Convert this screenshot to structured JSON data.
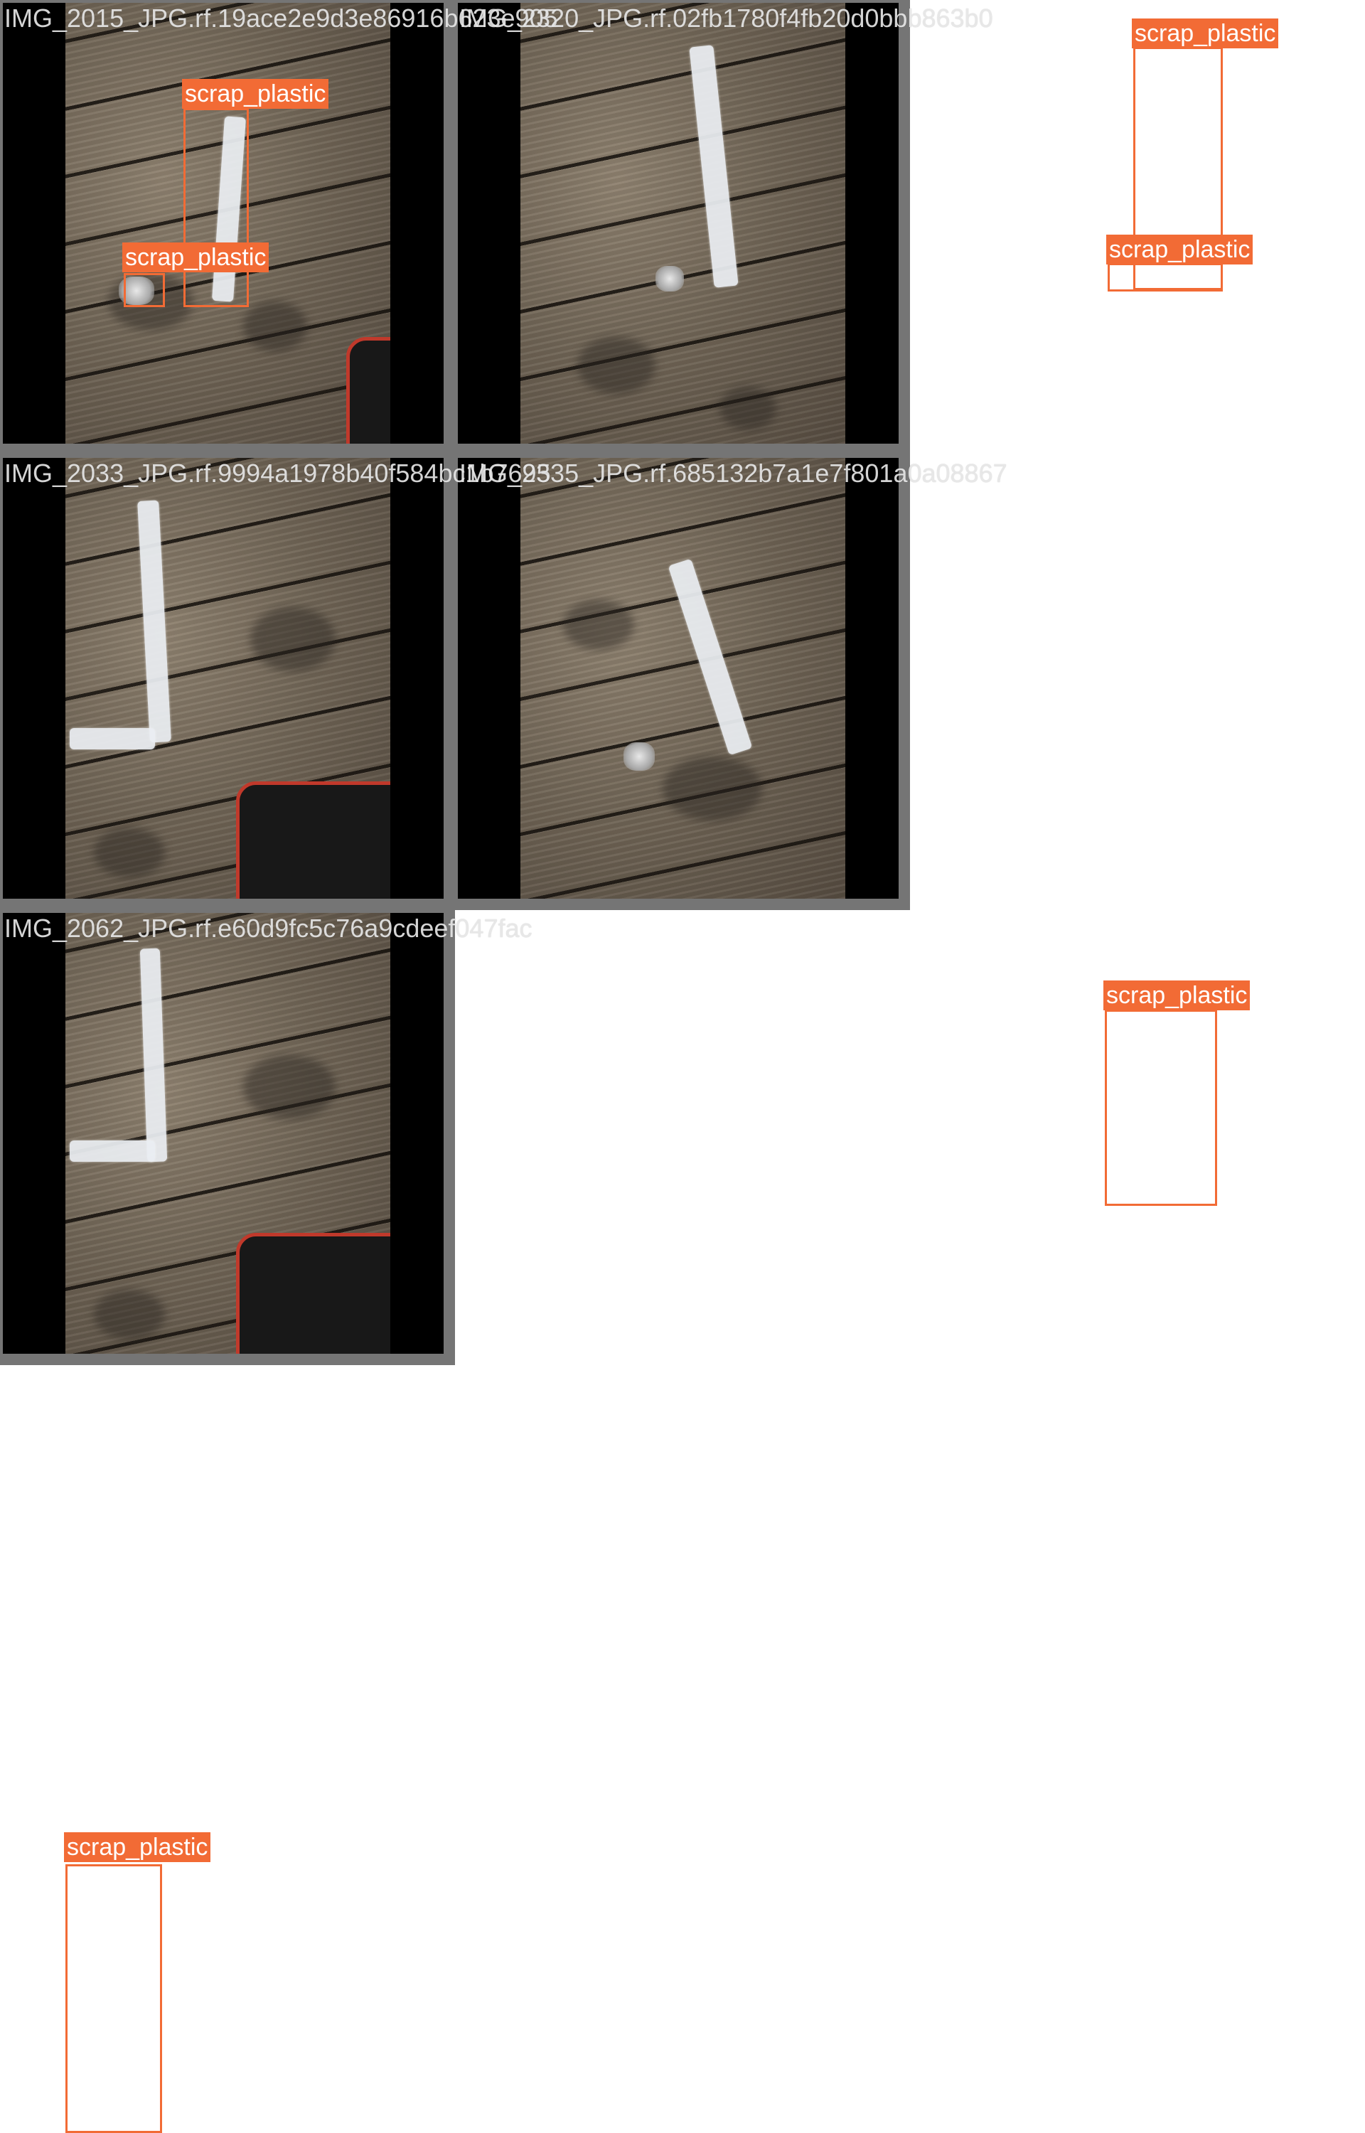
{
  "mosaic": {
    "accent_color": "#f26b35",
    "tiles": [
      {
        "filename": "IMG_2015_JPG.rf.19ace2e9d3e86916b623e905",
        "detections": [
          {
            "label": "scrap_plastic"
          },
          {
            "label": "scrap_plastic"
          }
        ]
      },
      {
        "filename": "IMG_2320_JPG.rf.02fb1780f4fb20d0bbb863b0",
        "detections": [
          {
            "label": "scrap_plastic"
          },
          {
            "label": "scrap_plastic"
          }
        ]
      },
      {
        "filename": "IMG_2033_JPG.rf.9994a1978b40f584bc1b7695",
        "detections": [
          {
            "label": "scrap_plastic"
          }
        ]
      },
      {
        "filename": "IMG_2335_JPG.rf.685132b7a1e7f801a0a08867",
        "detections": [
          {
            "label": "scrap_plastic"
          }
        ]
      },
      {
        "filename": "IMG_2062_JPG.rf.e60d9fc5c76a9cdeef047fac",
        "detections": [
          {
            "label": "scrap_plastic"
          }
        ]
      }
    ]
  }
}
